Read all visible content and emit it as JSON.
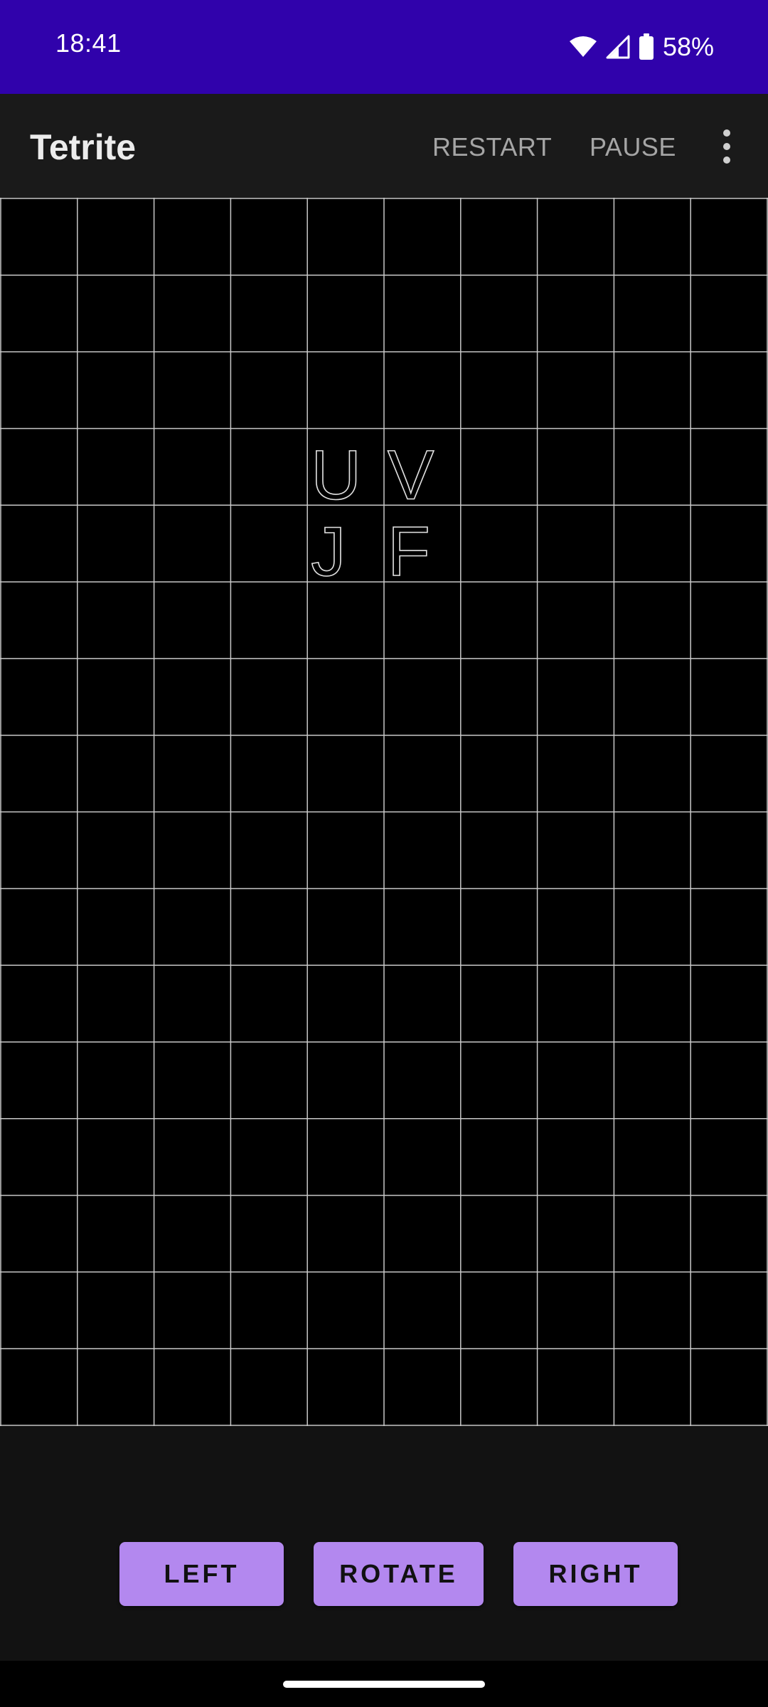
{
  "status_bar": {
    "time": "18:41",
    "battery": "58%",
    "icons": [
      "wifi-icon",
      "cellular-signal-icon",
      "battery-icon"
    ]
  },
  "app_bar": {
    "title": "Tetrite",
    "actions": {
      "restart": "RESTART",
      "pause": "PAUSE"
    },
    "overflow_icon": "more-vert-icon"
  },
  "board": {
    "columns": 10,
    "rows": 16,
    "grid_color": "#c8c8c8",
    "background": "#000000",
    "piece_letters": [
      {
        "letter": "U",
        "col": 4,
        "row": 3
      },
      {
        "letter": "V",
        "col": 5,
        "row": 3
      },
      {
        "letter": "J",
        "col": 4,
        "row": 4
      },
      {
        "letter": "F",
        "col": 5,
        "row": 4
      }
    ]
  },
  "controls": {
    "left": "LEFT",
    "rotate": "ROTATE",
    "right": "RIGHT",
    "button_color": "#b388ef"
  },
  "colors": {
    "status_bar": "#3002ab",
    "app_bar": "#1a1a1a",
    "background": "#121212"
  }
}
